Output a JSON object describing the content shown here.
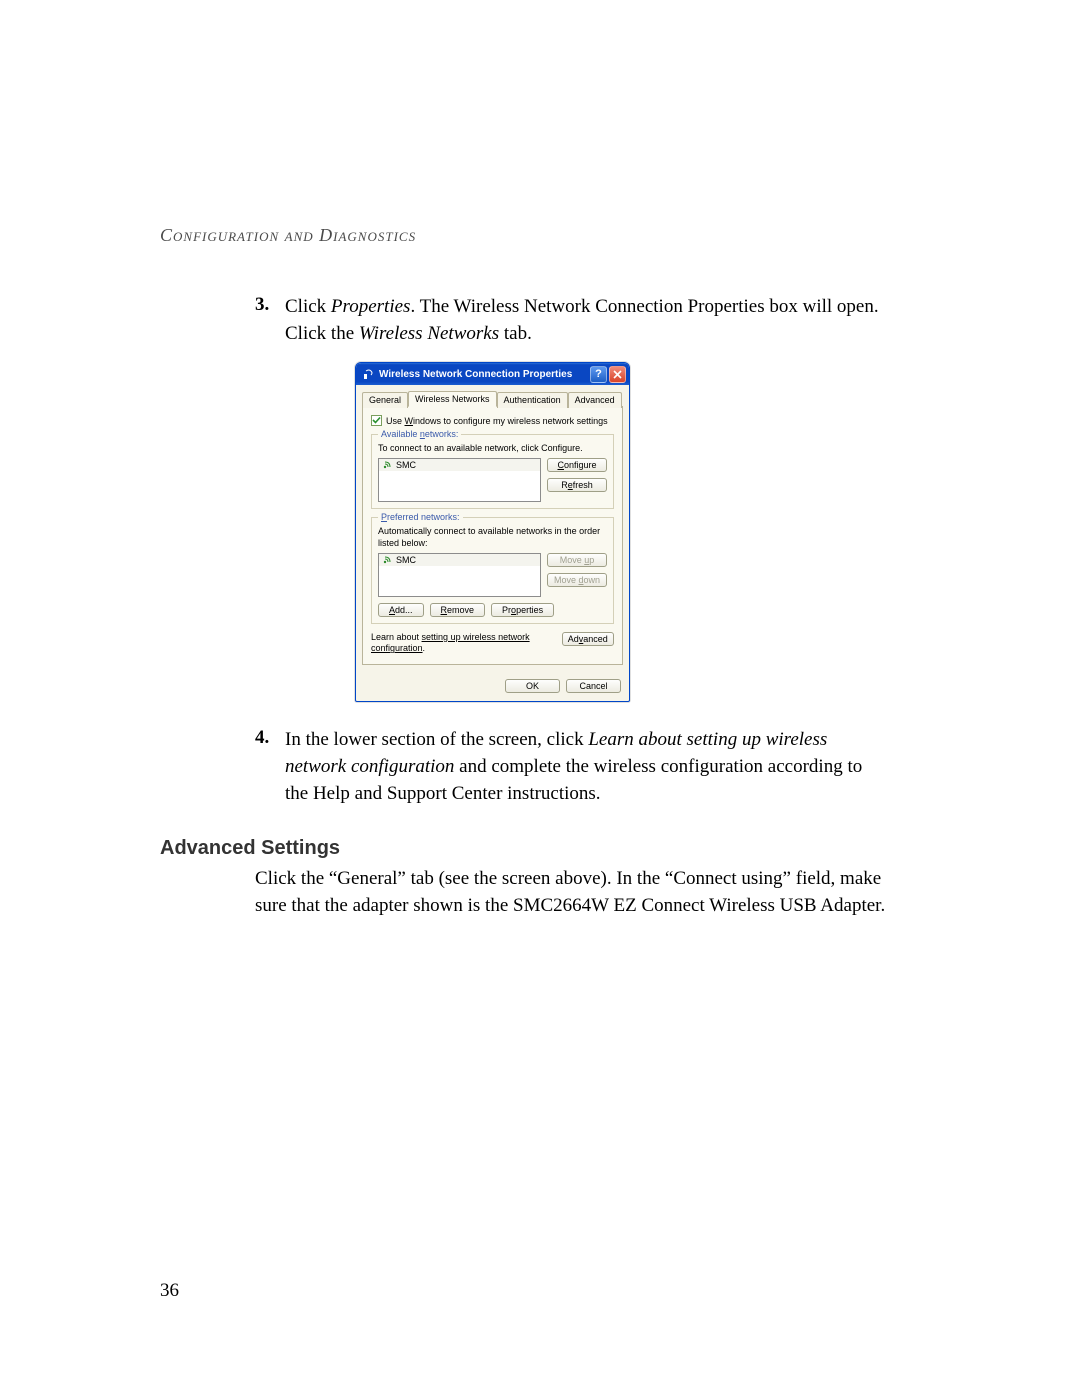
{
  "header": "Configuration and Diagnostics",
  "step3": {
    "num": "3.",
    "pre": "Click ",
    "em1": "Properties",
    "mid": ". The Wireless Network Connection Properties box will open.  Click the ",
    "em2": "Wireless Networks",
    "post": " tab."
  },
  "dialog": {
    "title": "Wireless Network Connection Properties",
    "tabs": {
      "general": "General",
      "wireless": "Wireless Networks",
      "auth": "Authentication",
      "advanced": "Advanced"
    },
    "checkbox_label_pre": "Use ",
    "checkbox_label_u": "W",
    "checkbox_label_post": "indows to configure my wireless network settings",
    "available": {
      "legend_pre": "Available ",
      "legend_u": "n",
      "legend_post": "etworks:",
      "instr": "To connect to an available network, click Configure.",
      "item": "SMC",
      "configure_u": "C",
      "configure_post": "onfigure",
      "refresh_pre": "R",
      "refresh_u": "e",
      "refresh_post": "fresh"
    },
    "preferred": {
      "legend_u": "P",
      "legend_post": "referred networks:",
      "instr": "Automatically connect to available networks in the order listed below:",
      "item": "SMC",
      "moveup_pre": "Move ",
      "moveup_u": "u",
      "moveup_post": "p",
      "movedown_pre": "Move ",
      "movedown_u": "d",
      "movedown_post": "own",
      "add_u": "A",
      "add_post": "dd...",
      "remove_u": "R",
      "remove_post": "emove",
      "props_pre": "Pr",
      "props_u": "o",
      "props_post": "perties"
    },
    "learn_pre": "Learn about ",
    "learn_link": "setting up wireless network configuration",
    "learn_post": ".",
    "advanced_btn_pre": "Ad",
    "advanced_btn_u": "v",
    "advanced_btn_post": "anced",
    "ok": "OK",
    "cancel": "Cancel"
  },
  "step4": {
    "num": "4.",
    "pre": "In the lower section of the screen, click ",
    "em1": "Learn about setting up wireless network configuration",
    "post": " and complete the wireless configuration according to the Help and Support Center instructions."
  },
  "subheading": "Advanced Settings",
  "paragraph": "Click the “General” tab (see the screen above). In the “Connect using” field, make sure that the adapter shown is the SMC2664W EZ Connect Wireless USB Adapter.",
  "page_number": "36"
}
